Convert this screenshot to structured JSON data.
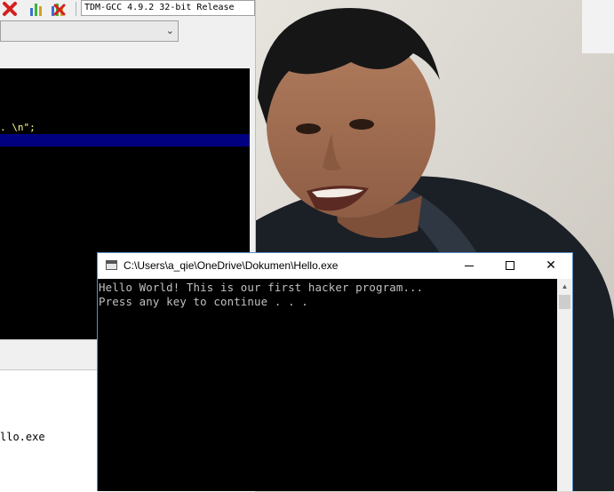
{
  "ide": {
    "compiler_selector": "TDM-GCC 4.9.2 32-bit Release",
    "editor_visible_text": ". \\n\";",
    "log_visible_text": "llo.exe",
    "toolbar_icons": [
      "delete-red-x-icon",
      "chart-icon",
      "delete-chart-icon"
    ]
  },
  "console": {
    "title": "C:\\Users\\a_qie\\OneDrive\\Dokumen\\Hello.exe",
    "lines": [
      "Hello World! This is our first hacker program...",
      "Press any key to continue . . ."
    ],
    "buttons": {
      "minimize_icon": "minimize-icon",
      "maximize_icon": "maximize-icon",
      "close_label": "✕"
    }
  },
  "colors": {
    "editor_bg": "#000000",
    "editor_highlight": "#000080",
    "console_border": "#5a8fc7",
    "console_text": "#c0c0c0"
  }
}
